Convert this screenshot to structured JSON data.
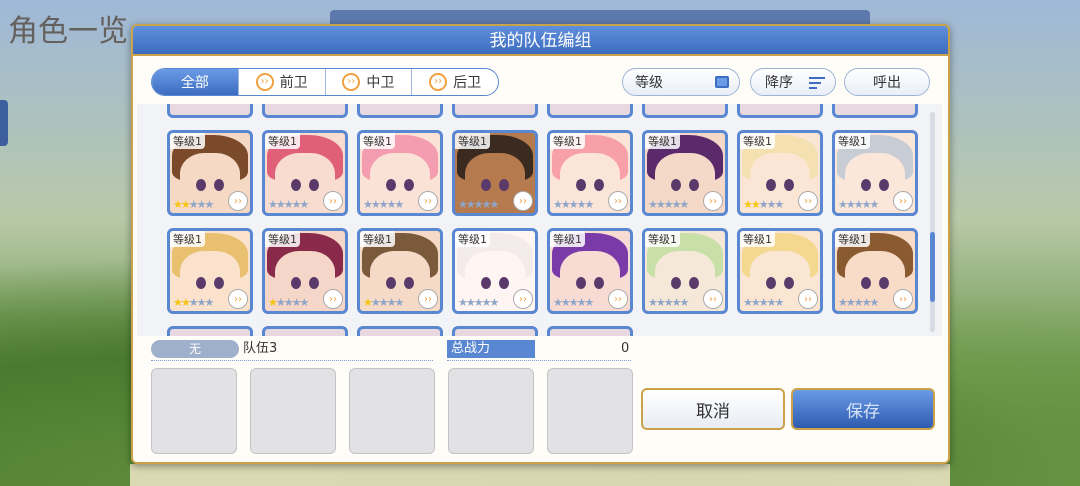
{
  "background": {
    "screen_title": "角色一览"
  },
  "dialog": {
    "title": "我的队伍编组"
  },
  "filters": {
    "tabs": [
      {
        "label": "全部",
        "icon": "",
        "active": true
      },
      {
        "label": "前卫",
        "icon": "front-role-icon",
        "active": false
      },
      {
        "label": "中卫",
        "icon": "middle-role-icon",
        "active": false
      },
      {
        "label": "后卫",
        "icon": "back-role-icon",
        "active": false
      }
    ],
    "sort_label": "等级",
    "order_label": "降序",
    "call_label": "呼出"
  },
  "characters": {
    "row1": [
      {
        "level": "等级1",
        "stars": 2,
        "hair": "#7a4a2a",
        "skin": "#f6d9c4"
      },
      {
        "level": "等级1",
        "stars": 0,
        "hair": "#e0607a",
        "skin": "#f8dcd0"
      },
      {
        "level": "等级1",
        "stars": 0,
        "hair": "#f49cb0",
        "skin": "#fbe2d6"
      },
      {
        "level": "等级1",
        "stars": 0,
        "hair": "#3a2a20",
        "skin": "#b57a4e"
      },
      {
        "level": "等级1",
        "stars": 0,
        "hair": "#f8a0a8",
        "skin": "#fbe4d8"
      },
      {
        "level": "等级1",
        "stars": 0,
        "hair": "#5a2a6a",
        "skin": "#f4d8c8"
      },
      {
        "level": "等级1",
        "stars": 2,
        "hair": "#f4e0b0",
        "skin": "#fbe6d6"
      },
      {
        "level": "等级1",
        "stars": 0,
        "hair": "#c8ccd4",
        "skin": "#fbe6da"
      }
    ],
    "row2": [
      {
        "level": "等级1",
        "stars": 2,
        "hair": "#e8c070",
        "skin": "#fbe2cc"
      },
      {
        "level": "等级1",
        "stars": 1,
        "hair": "#8a2a4a",
        "skin": "#f6d6c8"
      },
      {
        "level": "等级1",
        "stars": 1,
        "hair": "#7a5a3a",
        "skin": "#f6dac8"
      },
      {
        "level": "等级1",
        "stars": 0,
        "hair": "#f4ecea",
        "skin": "#fff6f4"
      },
      {
        "level": "等级1",
        "stars": 0,
        "hair": "#7a3aa8",
        "skin": "#f8dcd4"
      },
      {
        "level": "等级1",
        "stars": 0,
        "hair": "#c8e0a8",
        "skin": "#f6e8d8"
      },
      {
        "level": "等级1",
        "stars": 0,
        "hair": "#f4d890",
        "skin": "#fbe6d4"
      },
      {
        "level": "等级1",
        "stars": 0,
        "hair": "#8a5a30",
        "skin": "#f8dcc8"
      }
    ]
  },
  "team": {
    "tag": "无",
    "name": "队伍3",
    "power_label": "总战力",
    "power_value": "0"
  },
  "buttons": {
    "cancel": "取消",
    "save": "保存"
  }
}
